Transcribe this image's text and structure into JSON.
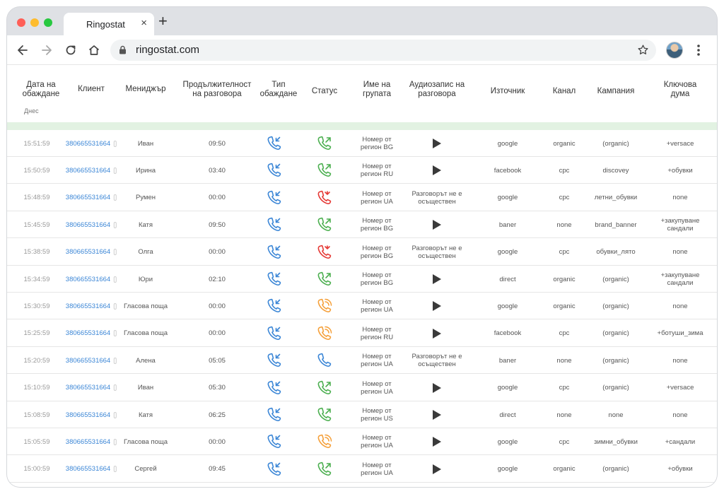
{
  "browser": {
    "tab_title": "Ringostat",
    "tab_close": "×",
    "new_tab": "+",
    "url": "ringostat.com"
  },
  "columns": {
    "date": "Дата на обаждане",
    "client": "Клиент",
    "manager": "Мениджър",
    "duration": "Продължителност на разговора",
    "call_type": "Тип обаждане",
    "status": "Статус",
    "group": "Име на групата",
    "audio": "Аудиозапис на разговора",
    "source": "Източник",
    "channel": "Канал",
    "campaign": "Кампания",
    "keyword": "Ключова дума"
  },
  "today_label": "Днес",
  "colors": {
    "green": "#4caf50",
    "red": "#e53935",
    "orange": "#f5a03a",
    "blue": "#3b86d6"
  },
  "rows": [
    {
      "time": "15:51:59",
      "client": "380665531664",
      "manager": "Иван",
      "duration": "09:50",
      "type": "incoming-call-icon",
      "status": "answered",
      "group": "Номер от регион BG",
      "audio": "play",
      "source": "google",
      "channel": "organic",
      "campaign": "(organic)",
      "keyword": "+versace"
    },
    {
      "time": "15:50:59",
      "client": "380665531664",
      "manager": "Ирина",
      "duration": "03:40",
      "type": "incoming-call-icon",
      "status": "answered",
      "group": "Номер от регион RU",
      "audio": "play",
      "source": "facebook",
      "channel": "cpc",
      "campaign": "discovey",
      "keyword": "+обувки"
    },
    {
      "time": "15:48:59",
      "client": "380665531664",
      "manager": "Румен",
      "duration": "00:00",
      "type": "incoming-call-icon",
      "status": "missed",
      "group": "Номер от регион UA",
      "audio": "Разговорът не е осъществен",
      "source": "google",
      "channel": "cpc",
      "campaign": "летни_обувки",
      "keyword": "none"
    },
    {
      "time": "15:45:59",
      "client": "380665531664",
      "manager": "Катя",
      "duration": "09:50",
      "type": "incoming-call-icon",
      "status": "answered",
      "group": "Номер от регион BG",
      "audio": "play",
      "source": "baner",
      "channel": "none",
      "campaign": "brand_banner",
      "keyword": "+закупуване сандали"
    },
    {
      "time": "15:38:59",
      "client": "380665531664",
      "manager": "Олга",
      "duration": "00:00",
      "type": "incoming-call-icon",
      "status": "missed",
      "group": "Номер от регион BG",
      "audio": "Разговорът не е осъществен",
      "source": "google",
      "channel": "cpc",
      "campaign": "обувки_лято",
      "keyword": "none"
    },
    {
      "time": "15:34:59",
      "client": "380665531664",
      "manager": "Юри",
      "duration": "02:10",
      "type": "incoming-call-icon",
      "status": "answered",
      "group": "Номер от регион BG",
      "audio": "play",
      "source": "direct",
      "channel": "organic",
      "campaign": "(organic)",
      "keyword": "+закупуване сандали"
    },
    {
      "time": "15:30:59",
      "client": "380665531664",
      "manager": "Гласова поща",
      "duration": "00:00",
      "type": "incoming-call-icon",
      "status": "voicemail",
      "group": "Номер от регион UA",
      "audio": "play",
      "source": "google",
      "channel": "organic",
      "campaign": "(organic)",
      "keyword": "none"
    },
    {
      "time": "15:25:59",
      "client": "380665531664",
      "manager": "Гласова поща",
      "duration": "00:00",
      "type": "incoming-call-icon",
      "status": "voicemail",
      "group": "Номер от регион RU",
      "audio": "play",
      "source": "facebook",
      "channel": "cpc",
      "campaign": "(organic)",
      "keyword": "+ботуши_зима"
    },
    {
      "time": "15:20:59",
      "client": "380665531664",
      "manager": "Алена",
      "duration": "05:05",
      "type": "incoming-call-icon",
      "status": "unanswered",
      "group": "Номер от регион UA",
      "audio": "Разговорът не е осъществен",
      "source": "baner",
      "channel": "none",
      "campaign": "(organic)",
      "keyword": "none"
    },
    {
      "time": "15:10:59",
      "client": "380665531664",
      "manager": "Иван",
      "duration": "05:30",
      "type": "incoming-call-icon",
      "status": "answered",
      "group": "Номер от регион UA",
      "audio": "play",
      "source": "google",
      "channel": "cpc",
      "campaign": "(organic)",
      "keyword": "+versace"
    },
    {
      "time": "15:08:59",
      "client": "380665531664",
      "manager": "Катя",
      "duration": "06:25",
      "type": "incoming-call-icon",
      "status": "answered",
      "group": "Номер от регион US",
      "audio": "play",
      "source": "direct",
      "channel": "none",
      "campaign": "none",
      "keyword": "none"
    },
    {
      "time": "15:05:59",
      "client": "380665531664",
      "manager": "Гласова поща",
      "duration": "00:00",
      "type": "incoming-call-icon",
      "status": "voicemail",
      "group": "Номер от регион UA",
      "audio": "play",
      "source": "google",
      "channel": "cpc",
      "campaign": "зимни_обувки",
      "keyword": "+сандали"
    },
    {
      "time": "15:00:59",
      "client": "380665531664",
      "manager": "Сергей",
      "duration": "09:45",
      "type": "incoming-call-icon",
      "status": "answered",
      "group": "Номер от регион UA",
      "audio": "play",
      "source": "google",
      "channel": "organic",
      "campaign": "(organic)",
      "keyword": "+обувки"
    }
  ]
}
